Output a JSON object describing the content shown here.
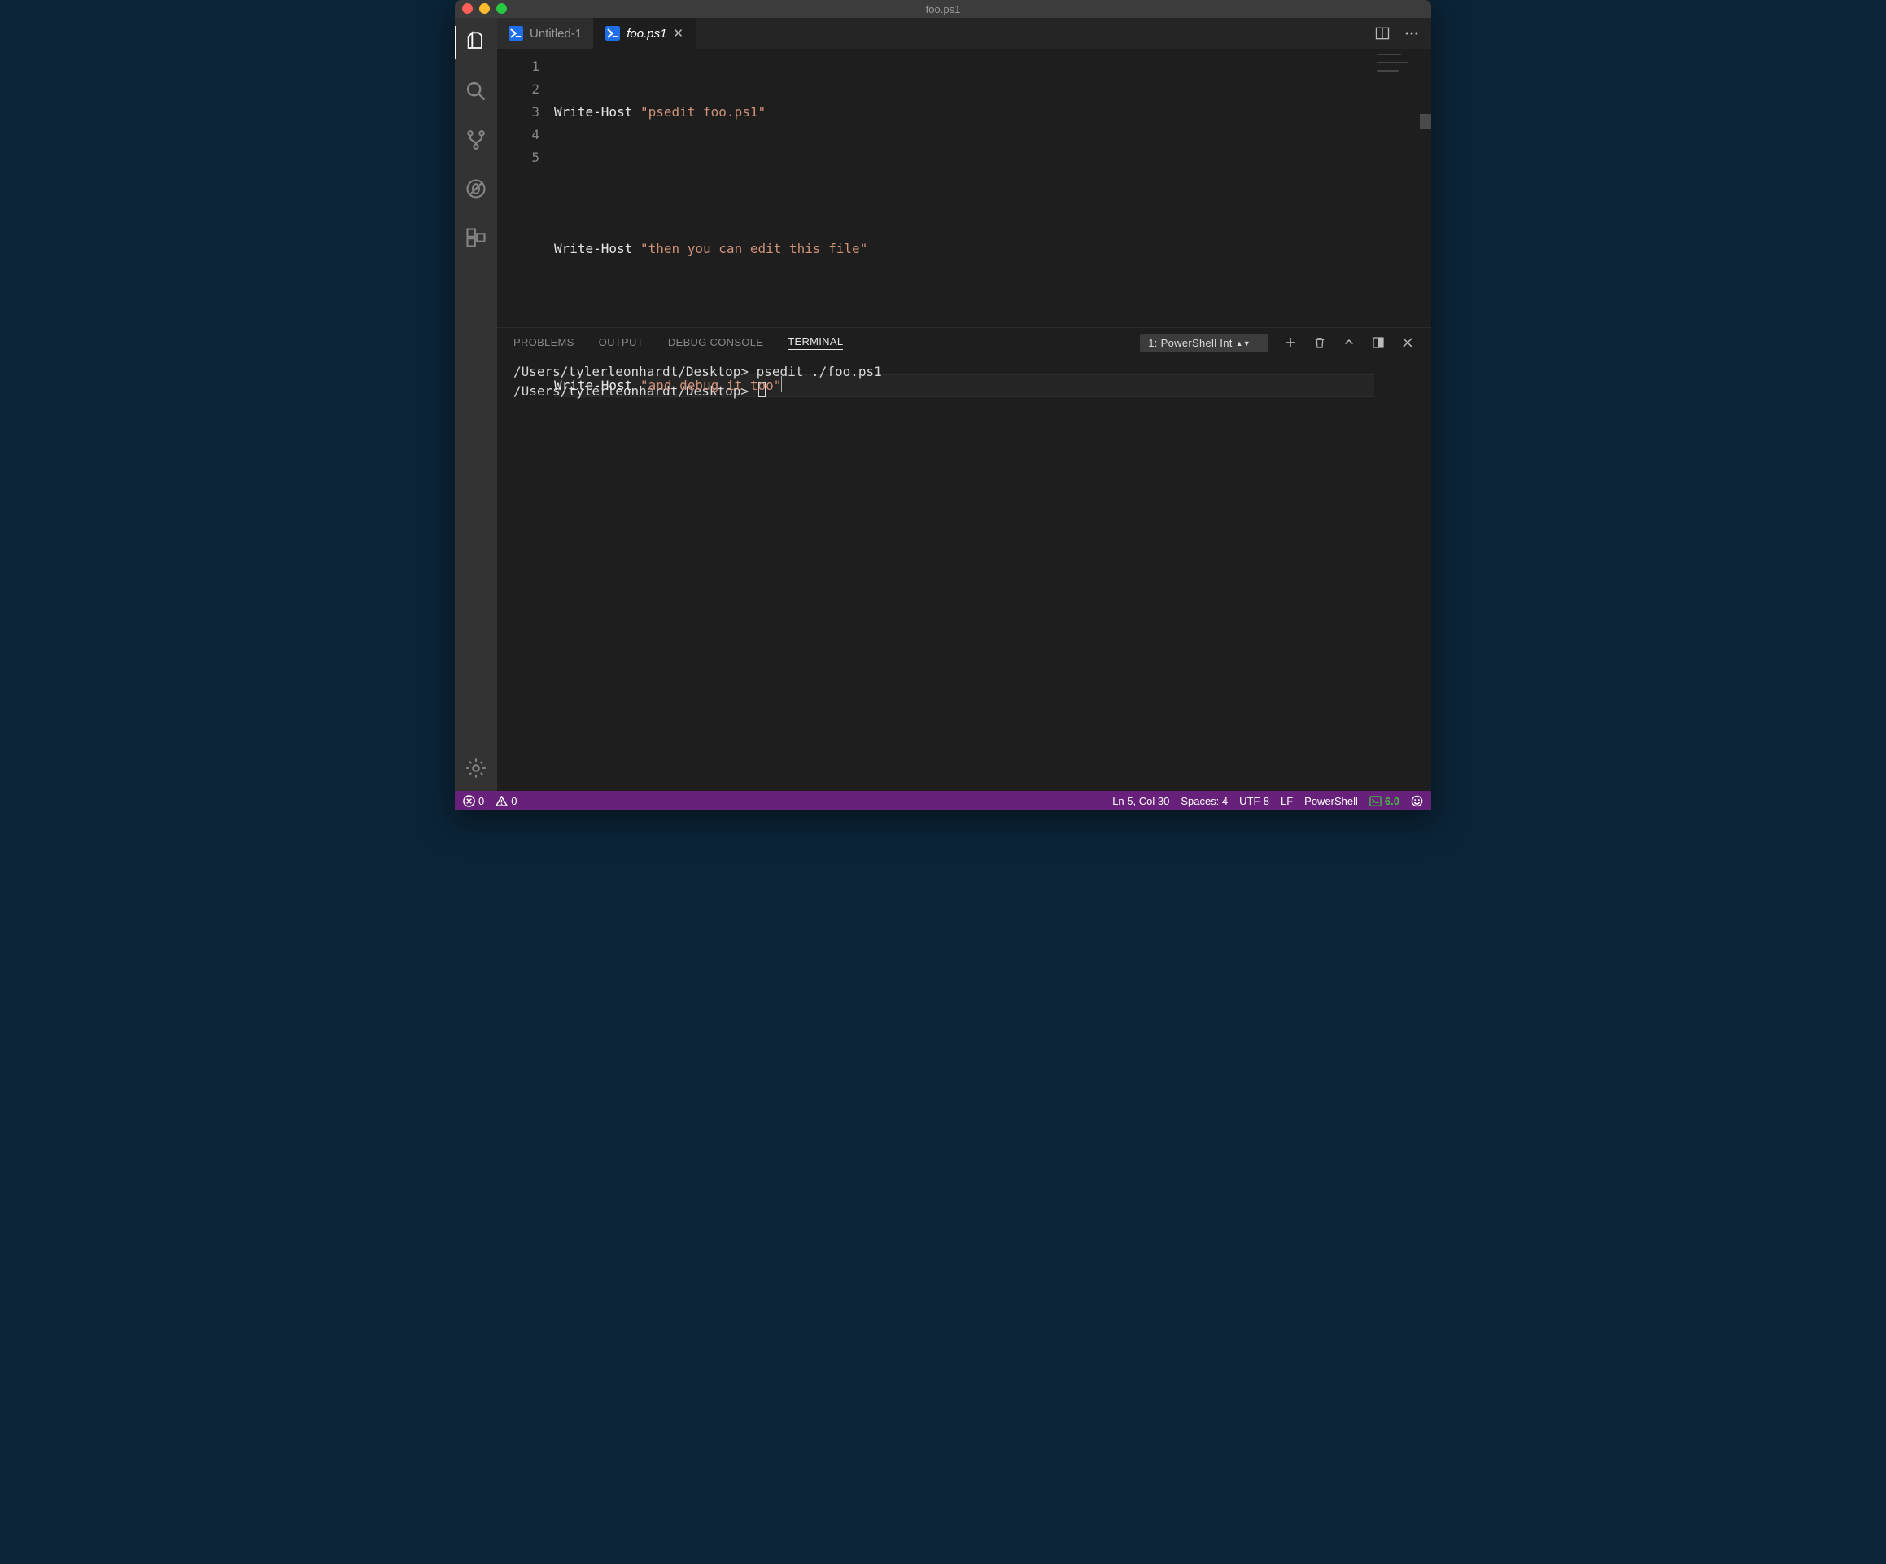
{
  "window": {
    "title": "foo.ps1"
  },
  "tabs": [
    {
      "label": "Untitled-1",
      "active": false,
      "close": false
    },
    {
      "label": "foo.ps1",
      "active": true,
      "close": true
    }
  ],
  "editor": {
    "lines": [
      {
        "n": "1",
        "cmd": "Write-Host",
        "str": "\"psedit foo.ps1\""
      },
      {
        "n": "2"
      },
      {
        "n": "3",
        "cmd": "Write-Host",
        "str": "\"then you can edit this file\""
      },
      {
        "n": "4"
      },
      {
        "n": "5",
        "cmd": "Write-Host",
        "str": "\"and debug it too\"",
        "current": true
      }
    ]
  },
  "panel": {
    "tabs": {
      "problems": "PROBLEMS",
      "output": "OUTPUT",
      "debug": "DEBUG CONSOLE",
      "terminal": "TERMINAL"
    },
    "activeTab": "terminal",
    "terminal": {
      "select_label": "1: PowerShell Int",
      "lines": [
        "/Users/tylerleonhardt/Desktop> psedit ./foo.ps1",
        "/Users/tylerleonhardt/Desktop> "
      ]
    }
  },
  "status": {
    "errors": "0",
    "warnings": "0",
    "cursor": "Ln 5, Col 30",
    "indent": "Spaces: 4",
    "encoding": "UTF-8",
    "eol": "LF",
    "language": "PowerShell",
    "ps_version": "6.0"
  }
}
